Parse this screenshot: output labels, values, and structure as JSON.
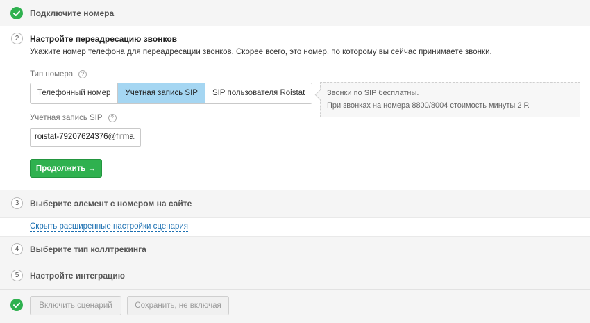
{
  "steps": {
    "s1": {
      "title": "Подключите номера",
      "status": "done"
    },
    "s2": {
      "number": "2",
      "title": "Настройте переадресацию звонков",
      "description": "Укажите номер телефона для переадресации звонков. Скорее всего, это номер, по которому вы сейчас принимаете звонки.",
      "type_label": "Тип номера",
      "type_options": [
        "Телефонный номер",
        "Учетная запись SIP",
        "SIP пользователя Roistat"
      ],
      "type_selected": "Учетная запись SIP",
      "hint": [
        "Звонки по SIP бесплатны.",
        "При звонках на номера 8800/8004 стоимость минуты 2 Р."
      ],
      "sip_label": "Учетная запись SIP",
      "sip_value": "roistat-79207624376@firma.",
      "continue_label": "Продолжить →"
    },
    "s3": {
      "number": "3",
      "title": "Выберите элемент с номером на сайте"
    },
    "advanced_link": "Скрыть расширенные настройки сценария",
    "s4": {
      "number": "4",
      "title": "Выберите тип коллтрекинга"
    },
    "s5": {
      "number": "5",
      "title": "Настройте интеграцию"
    }
  },
  "footer": {
    "enable_label": "Включить сценарий",
    "save_label": "Сохранить, не включая"
  },
  "colors": {
    "accent_green": "#2fb14f",
    "selected_blue": "#a5d6f2",
    "link_blue": "#1b6fb1"
  },
  "icons": {
    "help": "question-circle-icon",
    "done": "check-circle-icon"
  }
}
